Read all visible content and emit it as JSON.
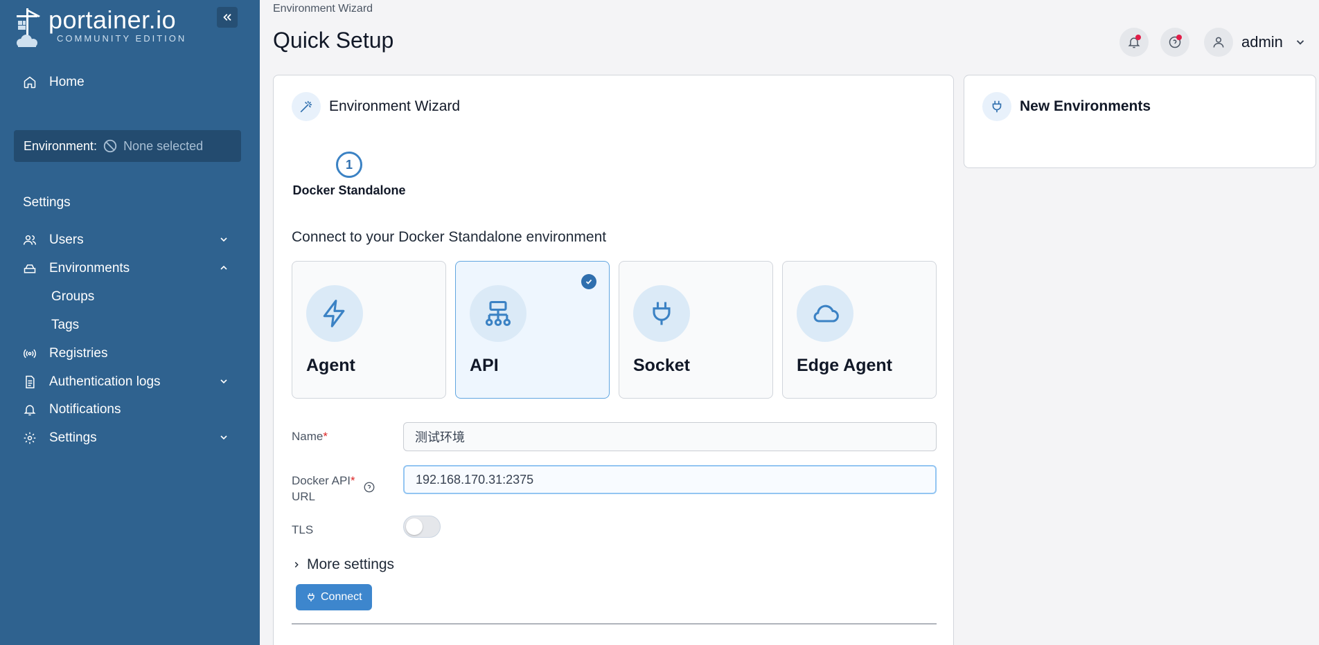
{
  "brand": {
    "name": "portainer.io",
    "edition": "COMMUNITY EDITION"
  },
  "sidebar": {
    "home": "Home",
    "environment_label": "Environment:",
    "environment_value": "None selected",
    "section": "Settings",
    "items": [
      {
        "label": "Users",
        "icon": "users-icon"
      },
      {
        "label": "Environments",
        "icon": "environments-icon"
      },
      {
        "label": "Groups"
      },
      {
        "label": "Tags"
      },
      {
        "label": "Registries",
        "icon": "registries-icon"
      },
      {
        "label": "Authentication logs",
        "icon": "logs-icon"
      },
      {
        "label": "Notifications",
        "icon": "bell-icon"
      },
      {
        "label": "Settings",
        "icon": "gear-icon"
      }
    ]
  },
  "header": {
    "breadcrumb": "Environment Wizard",
    "title": "Quick Setup",
    "user": "admin"
  },
  "wizard": {
    "title": "Environment Wizard",
    "step_number": "1",
    "step_label": "Docker Standalone",
    "heading": "Connect to your Docker Standalone environment",
    "options": [
      {
        "label": "Agent",
        "icon": "bolt-icon",
        "selected": false
      },
      {
        "label": "API",
        "icon": "network-icon",
        "selected": true
      },
      {
        "label": "Socket",
        "icon": "plug-icon",
        "selected": false
      },
      {
        "label": "Edge Agent",
        "icon": "cloud-icon",
        "selected": false
      }
    ],
    "name_label": "Name",
    "name_value": "测试环境",
    "url_label_1": "Docker API",
    "url_label_2": "URL",
    "url_value": "192.168.170.31:2375",
    "tls_label": "TLS",
    "more_settings": "More settings",
    "connect_button": "Connect"
  },
  "new_env": {
    "title": "New Environments"
  },
  "colors": {
    "sidebar": "#2f628f",
    "accent": "#3d86cd"
  }
}
